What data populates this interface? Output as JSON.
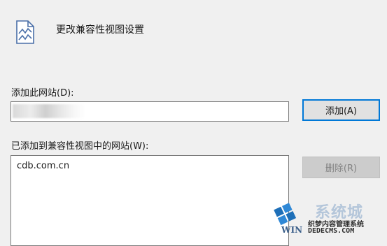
{
  "dialog": {
    "title": "更改兼容性视图设置",
    "icon": "compat-view-page-icon"
  },
  "add_site": {
    "label": "添加此网站(D):",
    "input_value": "",
    "button_label": "添加(A)"
  },
  "site_list": {
    "label": "已添加到兼容性视图中的网站(W):",
    "items": [
      "cdb.com.cn"
    ],
    "remove_button_label": "删除(R)"
  },
  "watermark": {
    "brand": "系统城",
    "sub_cn": "织梦内容管理系统",
    "sub_en": "DEDECMS.COM",
    "win": "WIN"
  },
  "colors": {
    "background": "#f0f0f0",
    "accent_border": "#0078d7",
    "disabled_text": "#838383"
  }
}
